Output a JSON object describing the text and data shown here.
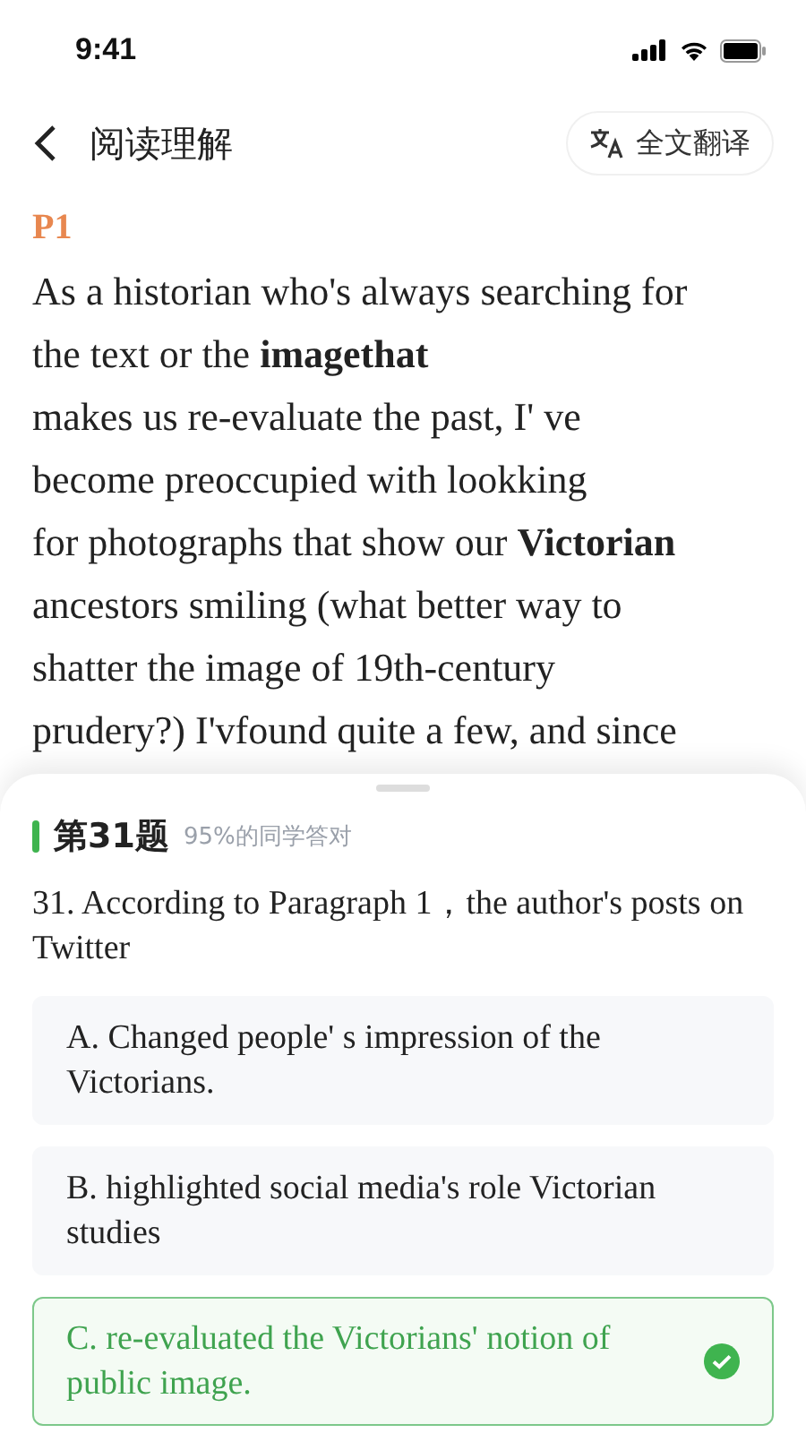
{
  "status_bar": {
    "time": "9:41"
  },
  "header": {
    "title": "阅读理解",
    "translate_button": "全文翻译"
  },
  "passage": {
    "label": "P1",
    "lines": [
      "As a historian who's always searching for",
      "the text or the **imagethat**",
      "makes us re-evaluate the past, I' ve",
      "become preoccupied with lookking",
      "for photographs that show our **Victorian**",
      "ancestors smiling (what better way to",
      "shatter the image of 19th-century",
      "prudery?) I'vfound quite a few, and since"
    ]
  },
  "question": {
    "number_label": "第31题",
    "stat": "95%的同学答对",
    "text": "31. According to Paragraph 1，the author's posts on Twitter",
    "options": [
      {
        "text": "A. Changed people' s impression of the Victorians.",
        "correct": false
      },
      {
        "text": "B. highlighted social media's role Victorian studies",
        "correct": false
      },
      {
        "text": "C. re-evaluated the Victorians' notion of public image.",
        "correct": true
      }
    ]
  }
}
